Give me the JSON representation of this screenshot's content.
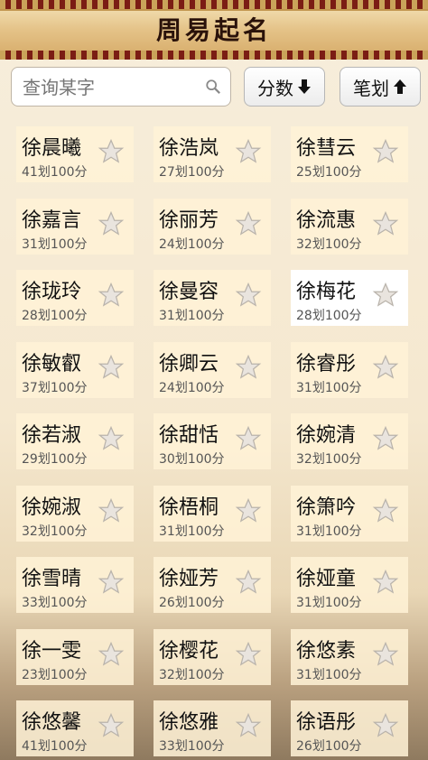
{
  "app": {
    "title": "周易起名"
  },
  "search": {
    "placeholder": "查询某字",
    "value": ""
  },
  "sort": {
    "score_label": "分数",
    "stroke_label": "笔划"
  },
  "colors": {
    "header": "#7b1d14",
    "card": "#fff2d6",
    "selected": "#ffffff"
  },
  "names": [
    {
      "name": "徐晨曦",
      "meta": "41划100分"
    },
    {
      "name": "徐浩岚",
      "meta": "27划100分"
    },
    {
      "name": "徐彗云",
      "meta": "25划100分"
    },
    {
      "name": "徐嘉言",
      "meta": "31划100分"
    },
    {
      "name": "徐丽芳",
      "meta": "24划100分"
    },
    {
      "name": "徐流惠",
      "meta": "32划100分"
    },
    {
      "name": "徐珑玲",
      "meta": "28划100分"
    },
    {
      "name": "徐曼容",
      "meta": "31划100分"
    },
    {
      "name": "徐梅花",
      "meta": "28划100分",
      "selected": true
    },
    {
      "name": "徐敏叡",
      "meta": "37划100分"
    },
    {
      "name": "徐卿云",
      "meta": "24划100分"
    },
    {
      "name": "徐睿彤",
      "meta": "31划100分"
    },
    {
      "name": "徐若淑",
      "meta": "29划100分"
    },
    {
      "name": "徐甜恬",
      "meta": "30划100分"
    },
    {
      "name": "徐婉清",
      "meta": "32划100分"
    },
    {
      "name": "徐婉淑",
      "meta": "32划100分"
    },
    {
      "name": "徐梧桐",
      "meta": "31划100分"
    },
    {
      "name": "徐箫吟",
      "meta": "31划100分"
    },
    {
      "name": "徐雪晴",
      "meta": "33划100分"
    },
    {
      "name": "徐娅芳",
      "meta": "26划100分"
    },
    {
      "name": "徐娅童",
      "meta": "31划100分"
    },
    {
      "name": "徐一雯",
      "meta": "23划100分"
    },
    {
      "name": "徐樱花",
      "meta": "32划100分"
    },
    {
      "name": "徐悠素",
      "meta": "31划100分"
    },
    {
      "name": "徐悠馨",
      "meta": "41划100分"
    },
    {
      "name": "徐悠雅",
      "meta": "33划100分"
    },
    {
      "name": "徐语彤",
      "meta": "26划100分"
    }
  ]
}
